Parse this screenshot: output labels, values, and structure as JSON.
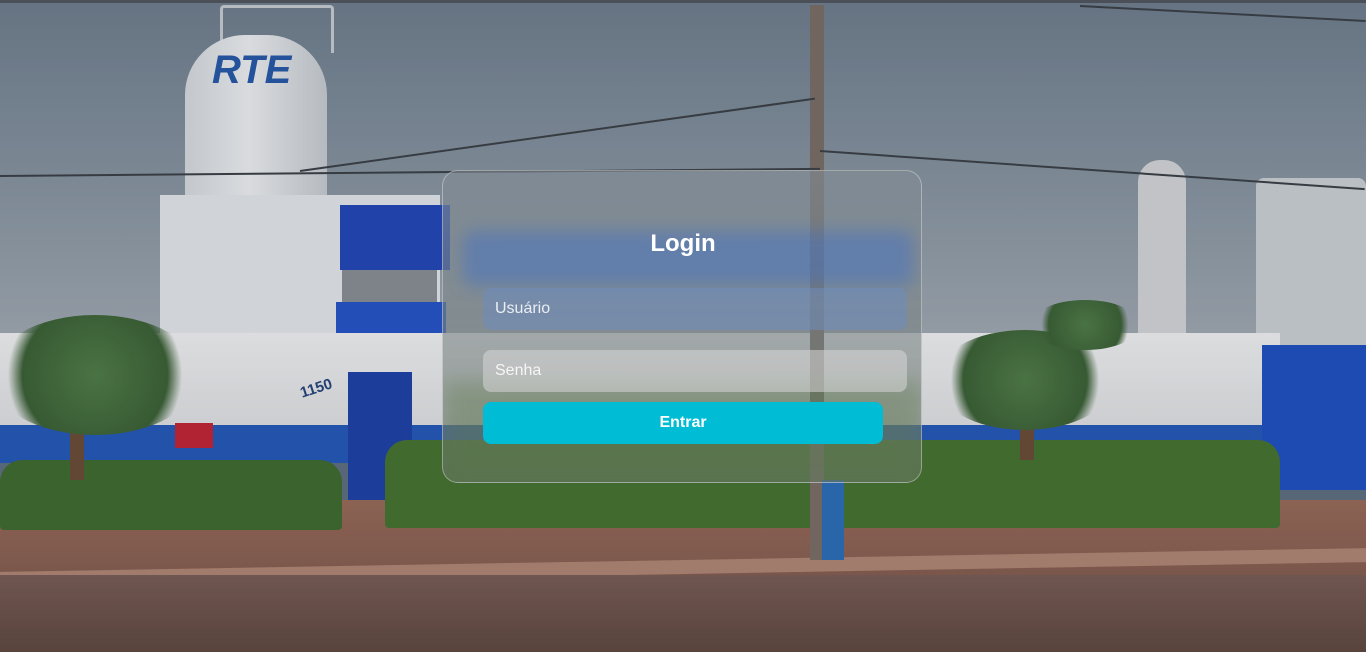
{
  "login": {
    "title": "Login",
    "username_placeholder": "Usuário",
    "password_placeholder": "Senha",
    "submit_label": "Entrar"
  },
  "background": {
    "silo_logo": "RTE",
    "building_number": "1150"
  },
  "colors": {
    "button": "#00bcd4",
    "title": "#ffffff"
  }
}
